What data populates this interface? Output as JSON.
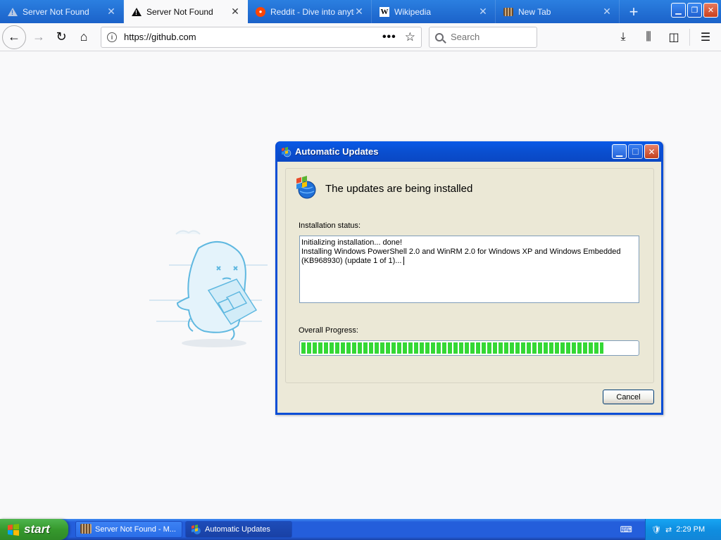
{
  "browser": {
    "tabs": [
      {
        "label": "Server Not Found",
        "icon": "warning-icon",
        "active": false
      },
      {
        "label": "Server Not Found",
        "icon": "warning-icon",
        "active": true
      },
      {
        "label": "Reddit - Dive into anyth",
        "icon": "reddit-icon",
        "active": false
      },
      {
        "label": "Wikipedia",
        "icon": "wikipedia-icon",
        "active": false
      },
      {
        "label": "New Tab",
        "icon": "newtab-icon",
        "active": false
      }
    ],
    "new_tab_symbol": "+",
    "url": "https://github.com",
    "search_placeholder": "Search"
  },
  "dialog": {
    "title": "Automatic Updates",
    "heading": "The updates are being installed",
    "status_label": "Installation status:",
    "status_lines": [
      "Initializing installation... done!",
      "Installing Windows PowerShell 2.0 and WinRM 2.0 for Windows XP and Windows Embedded",
      "(KB968930) (update 1 of 1)..."
    ],
    "progress_label": "Overall Progress:",
    "progress_percent": 90,
    "cancel_label": "Cancel"
  },
  "taskbar": {
    "start_label": "start",
    "tasks": [
      {
        "label": "Server Not Found - M...",
        "active": false
      },
      {
        "label": "Automatic Updates",
        "active": true
      }
    ],
    "clock": "2:29 PM"
  },
  "colors": {
    "firefox_tabstrip": "#1b62c9",
    "xp_titlebar": "#0a4fd0",
    "progress_green": "#35d835",
    "xp_start_green": "#36992d"
  }
}
